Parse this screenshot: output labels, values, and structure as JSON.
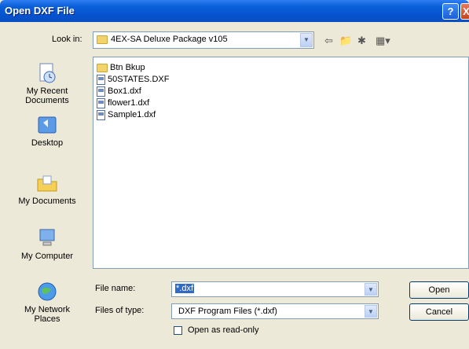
{
  "window": {
    "title": "Open DXF File"
  },
  "lookin": {
    "label": "Look in:",
    "value": "4EX-SA Deluxe Package v105"
  },
  "places": [
    {
      "label_line1": "My Recent",
      "label_line2": "Documents"
    },
    {
      "label_line1": "Desktop",
      "label_line2": ""
    },
    {
      "label_line1": "My Documents",
      "label_line2": ""
    },
    {
      "label_line1": "My Computer",
      "label_line2": ""
    },
    {
      "label_line1": "My Network",
      "label_line2": "Places"
    }
  ],
  "files": [
    {
      "name": "Btn Bkup",
      "icon": "folder-icon"
    },
    {
      "name": "50STATES.DXF",
      "icon": "dxf-file-icon"
    },
    {
      "name": "Box1.dxf",
      "icon": "dxf-file-icon"
    },
    {
      "name": "flower1.dxf",
      "icon": "dxf-file-icon"
    },
    {
      "name": "Sample1.dxf",
      "icon": "dxf-file-icon"
    }
  ],
  "file_name": {
    "label": "File name:",
    "value": "*.dxf"
  },
  "file_type": {
    "label": "Files of type:",
    "value": "DXF Program Files (*.dxf)"
  },
  "readonly": {
    "label": "Open as read-only",
    "checked": false
  },
  "buttons": {
    "open": "Open",
    "cancel": "Cancel",
    "help": "?",
    "close": "X"
  },
  "colors": {
    "titlebar": "#0553d0",
    "face": "#ece9d8",
    "selection": "#316ac5"
  }
}
